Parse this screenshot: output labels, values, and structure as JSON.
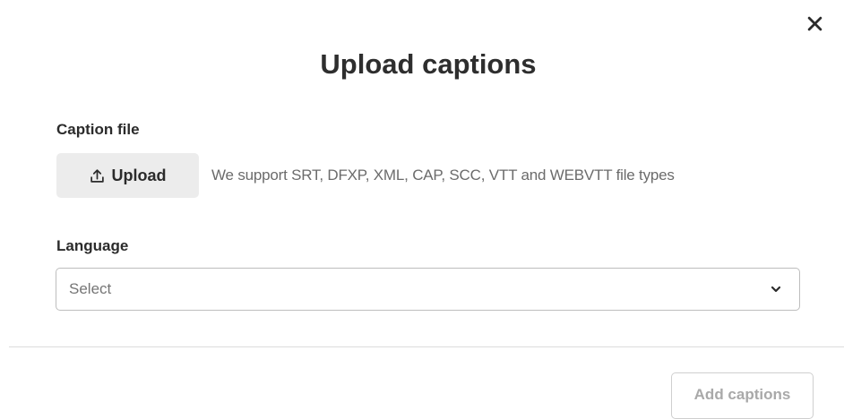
{
  "dialog": {
    "title": "Upload captions",
    "close_icon": "close-icon"
  },
  "caption_file": {
    "label": "Caption file",
    "upload_button_label": "Upload",
    "upload_icon": "upload-icon",
    "hint": "We support SRT, DFXP, XML, CAP, SCC, VTT and WEBVTT file types"
  },
  "language": {
    "label": "Language",
    "placeholder": "Select",
    "dropdown_icon": "chevron-down-icon"
  },
  "footer": {
    "add_button_label": "Add captions",
    "add_button_disabled": true
  },
  "colors": {
    "text": "#2b2b2b",
    "hint_text": "#6b6b6b",
    "upload_button_bg": "#ececec",
    "disabled_text": "#a9a9a9",
    "border": "#bdbdbd"
  }
}
